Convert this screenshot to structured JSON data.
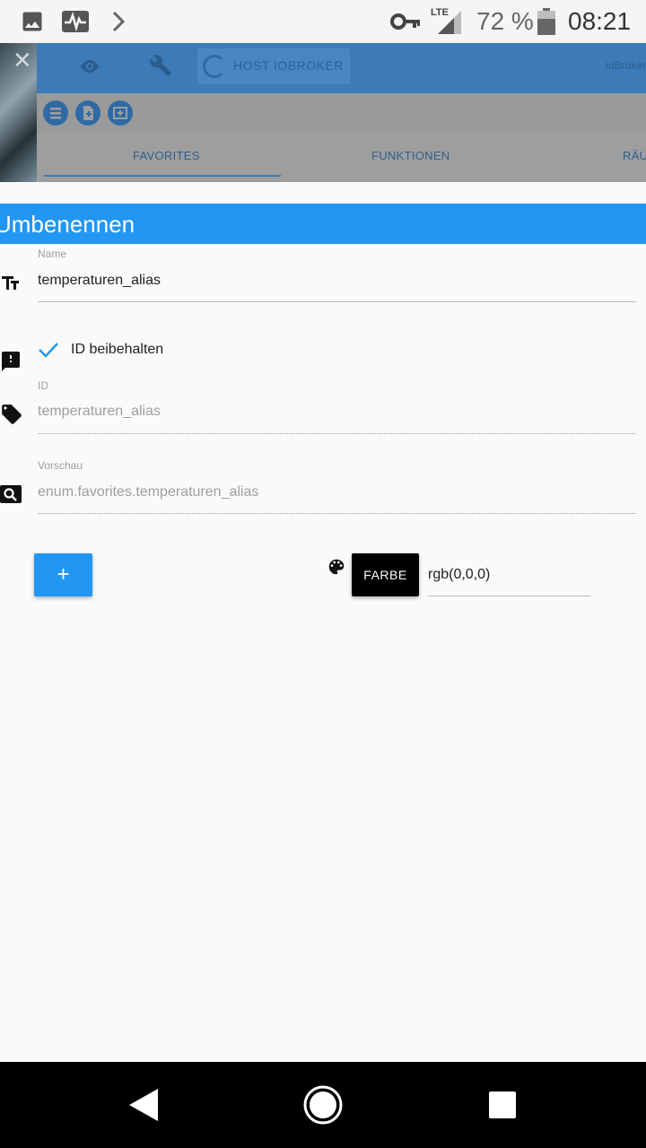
{
  "status_bar": {
    "network_label": "LTE",
    "battery_percent": "72 %",
    "time": "08:21",
    "icons": [
      "image-icon",
      "activity-icon",
      "chevron-right-icon",
      "key-icon",
      "signal-icon",
      "battery-icon"
    ]
  },
  "background_app": {
    "host_label": "HOST IOBROKER",
    "brand": "ioBroker",
    "tabs": [
      {
        "label": "FAVORITES"
      },
      {
        "label": "FUNKTIONEN"
      },
      {
        "label": "RÄU"
      }
    ]
  },
  "dialog": {
    "title": "Umbenennen",
    "name_field": {
      "label": "Name",
      "value": "temperaturen_alias"
    },
    "keep_id": {
      "label": "ID beibehalten",
      "checked": true
    },
    "id_field": {
      "label": "ID",
      "value": "temperaturen_alias"
    },
    "preview_field": {
      "label": "Vorschau",
      "value": "enum.favorites.temperaturen_alias"
    },
    "add_button_label": "+",
    "color_button_label": "FARBE",
    "color_value": "rgb(0,0,0)"
  },
  "colors": {
    "accent": "#2196f3",
    "toolbar": "#3d7ab8"
  }
}
